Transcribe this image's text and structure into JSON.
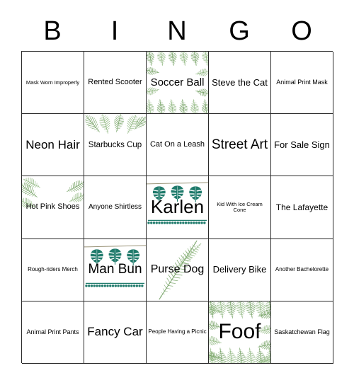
{
  "header": {
    "letters": [
      "B",
      "I",
      "N",
      "G",
      "O"
    ]
  },
  "grid": {
    "rows": 5,
    "columns": 5,
    "cells": [
      {
        "label": "Mask Worn Improperly",
        "size": "sm",
        "decoration": "none"
      },
      {
        "label": "Rented Scooter",
        "size": "lg",
        "decoration": "none"
      },
      {
        "label": "Soccer Ball",
        "size": "lg",
        "decoration": "palm-frame-light"
      },
      {
        "label": "Steve the Cat",
        "size": "md",
        "decoration": "none"
      },
      {
        "label": "Animal Print Mask",
        "size": "md",
        "decoration": "none"
      },
      {
        "label": "Neon Hair",
        "size": "xxl",
        "decoration": "none"
      },
      {
        "label": "Starbucks Cup",
        "size": "sm",
        "decoration": "palm-top-light"
      },
      {
        "label": "Cat On a Leash",
        "size": "md",
        "decoration": "none"
      },
      {
        "label": "Street Art",
        "size": "xl",
        "decoration": "none"
      },
      {
        "label": "For Sale Sign",
        "size": "md",
        "decoration": "none"
      },
      {
        "label": "Hot Pink Shoes",
        "size": "md",
        "decoration": "palm-left-light"
      },
      {
        "label": "Anyone Shirtless",
        "size": "md",
        "decoration": "none"
      },
      {
        "label": "Karlen",
        "size": "xl",
        "decoration": "monstera-garland"
      },
      {
        "label": "Kid With Ice Cream Cone",
        "size": "sm",
        "decoration": "none"
      },
      {
        "label": "The Lafayette",
        "size": "md",
        "decoration": "none"
      },
      {
        "label": "Rough-riders Merch",
        "size": "md",
        "decoration": "none"
      },
      {
        "label": "Man Bun",
        "size": "xl",
        "decoration": "monstera-garland"
      },
      {
        "label": "Purse Dog",
        "size": "xl",
        "decoration": "palm-single-frond"
      },
      {
        "label": "Delivery Bike",
        "size": "md",
        "decoration": "none"
      },
      {
        "label": "Another Bachelorette",
        "size": "xs",
        "decoration": "none"
      },
      {
        "label": "Animal Print Pants",
        "size": "md",
        "decoration": "none"
      },
      {
        "label": "Fancy Car",
        "size": "xl",
        "decoration": "none"
      },
      {
        "label": "People Having a Picnic",
        "size": "md",
        "decoration": "none"
      },
      {
        "label": "Foof",
        "size": "xxl",
        "decoration": "palm-frame-full"
      },
      {
        "label": "Saskatchewan Flag",
        "size": "xs",
        "decoration": "none"
      }
    ]
  },
  "colors": {
    "grid_line": "#2b2b2b",
    "text": "#000000",
    "leaf_light_green": "#8bb47a",
    "leaf_mid_green": "#6f9e5e",
    "leaf_dark_teal": "#1f7a6b",
    "background": "#ffffff"
  }
}
